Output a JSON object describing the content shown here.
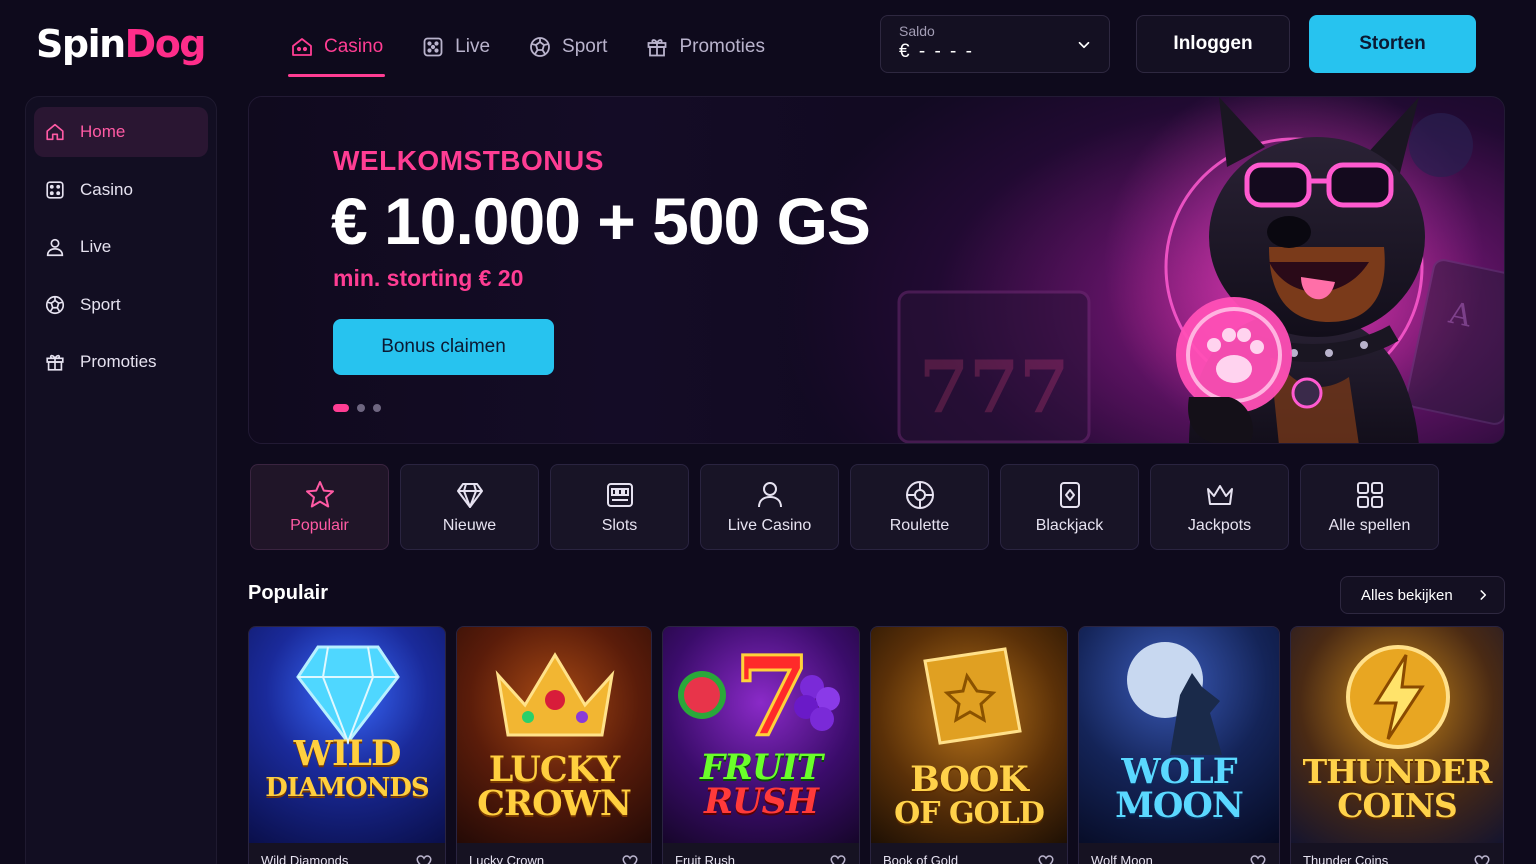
{
  "header": {
    "logo": {
      "part1": "Spin",
      "part2": "Dog"
    },
    "nav": [
      {
        "label": "Casino",
        "icon": "casino-icon",
        "active": true
      },
      {
        "label": "Live",
        "icon": "dice-icon",
        "active": false
      },
      {
        "label": "Sport",
        "icon": "ball-icon",
        "active": false
      },
      {
        "label": "Promoties",
        "icon": "gift-icon",
        "active": false
      }
    ],
    "balance": {
      "label": "Saldo",
      "value": "€ - - - -"
    },
    "login_label": "Inloggen",
    "deposit_label": "Storten"
  },
  "sidebar": {
    "items": [
      {
        "label": "Home",
        "icon": "home-icon",
        "active": true
      },
      {
        "label": "Casino",
        "icon": "dice-icon",
        "active": false
      },
      {
        "label": "Live",
        "icon": "person-icon",
        "active": false
      },
      {
        "label": "Sport",
        "icon": "ball-icon",
        "active": false
      },
      {
        "label": "Promoties",
        "icon": "gift-icon",
        "active": false
      }
    ]
  },
  "hero": {
    "kicker": "WELKOMSTBONUS",
    "amount": "€ 10.000 + 500 GS",
    "subtitle": "min. storting € 20",
    "cta": "Bonus claimen",
    "slides": 3,
    "active_slide": 1
  },
  "categories": [
    {
      "label": "Populair",
      "icon": "star-icon",
      "active": true
    },
    {
      "label": "Nieuwe",
      "icon": "diamond-icon",
      "active": false
    },
    {
      "label": "Slots",
      "icon": "slot-machine-icon",
      "active": false
    },
    {
      "label": "Live Casino",
      "icon": "person-icon",
      "active": false
    },
    {
      "label": "Roulette",
      "icon": "roulette-icon",
      "active": false
    },
    {
      "label": "Blackjack",
      "icon": "card-icon",
      "active": false
    },
    {
      "label": "Jackpots",
      "icon": "crown-icon",
      "active": false
    },
    {
      "label": "Alle spellen",
      "icon": "grid-icon",
      "active": false
    }
  ],
  "popular": {
    "title": "Populair",
    "see_all": "Alles bekijken",
    "games": [
      {
        "name": "Wild Diamonds",
        "art_line1": "WILD",
        "art_line2": "DIAMONDS"
      },
      {
        "name": "Lucky Crown",
        "art_line1": "LUCKY",
        "art_line2": "CROWN"
      },
      {
        "name": "Fruit Rush",
        "art_line1": "FRUIT",
        "art_line2": "RUSH"
      },
      {
        "name": "Book of Gold",
        "art_line1": "BOOK",
        "art_line2": "OF GOLD"
      },
      {
        "name": "Wolf Moon",
        "art_line1": "WOLF",
        "art_line2": "MOON"
      },
      {
        "name": "Thunder Coins",
        "art_line1": "THUNDER",
        "art_line2": "COINS"
      }
    ]
  },
  "colors": {
    "accent_pink": "#ff3d93",
    "accent_cyan": "#27c3ef",
    "background": "#0e0a1c"
  }
}
